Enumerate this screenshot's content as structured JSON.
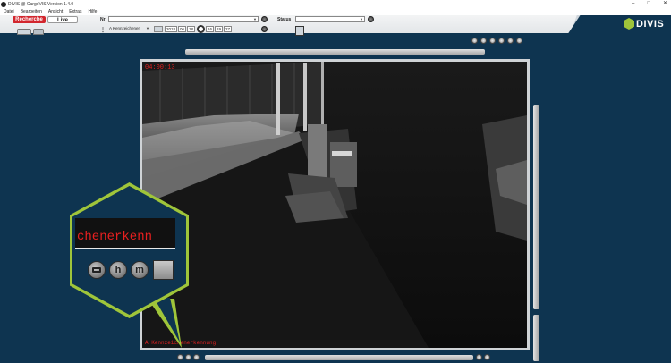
{
  "window": {
    "title": "DIVIS @ CargoVIS Version 1.4.0"
  },
  "menu": [
    "Datei",
    "Bearbeiten",
    "Ansicht",
    "Extras",
    "Hilfe"
  ],
  "tabs": {
    "recherche": "Recherche",
    "live": "Live"
  },
  "search": {
    "nr_label": "Nr:",
    "nr_value": "",
    "status_label": "Status",
    "status_value": "",
    "mode_value": "A Kennzeichener",
    "date_year": "2018",
    "date_month": "06",
    "date_day": "18",
    "time_hour": "16",
    "time_minute": "19",
    "time_second": "27"
  },
  "logo": {
    "text": "DIVIS"
  },
  "video": {
    "timecode": "04:00:13",
    "caption": "A Kennzeichenerkennung"
  },
  "callout": {
    "text": "chenerkenn",
    "button_h": "h",
    "button_m": "m"
  },
  "colors": {
    "background": "#0e3450",
    "accent_green": "#9fc53a",
    "recherche_red": "#d2262d",
    "overlay_red": "#e02020"
  }
}
